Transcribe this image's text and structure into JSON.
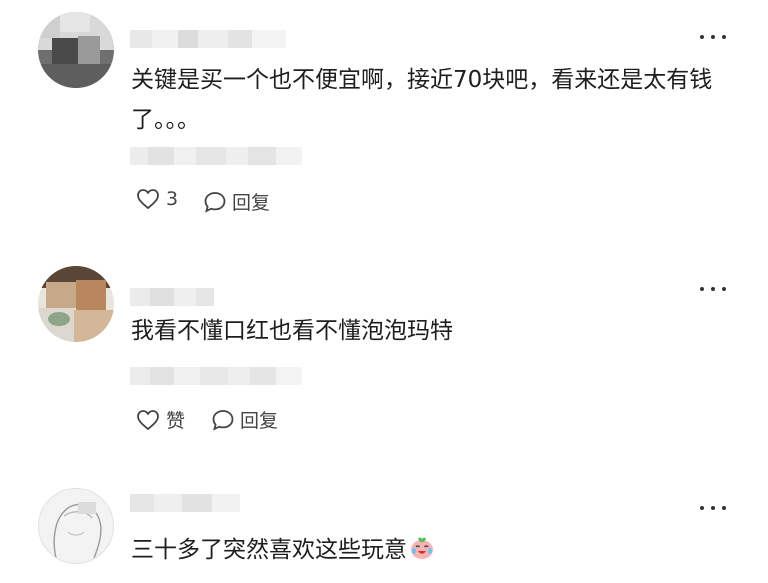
{
  "comments": [
    {
      "text": "关键是买一个也不便宜啊，接近70块吧，看来还是太有钱了。。。",
      "like_count": "3",
      "reply_label": "回复",
      "more_icon": "more-dots-icon"
    },
    {
      "text": "我看不懂口红也看不懂泡泡玛特",
      "like_label": "赞",
      "reply_label": "回复",
      "more_icon": "more-dots-icon"
    },
    {
      "text": "三十多了突然喜欢这些玩意",
      "emoji": "crying-laughing-face-emoji",
      "more_icon": "more-dots-icon"
    }
  ],
  "icons": {
    "like": "heart-outline-icon",
    "reply": "speech-bubble-icon"
  }
}
